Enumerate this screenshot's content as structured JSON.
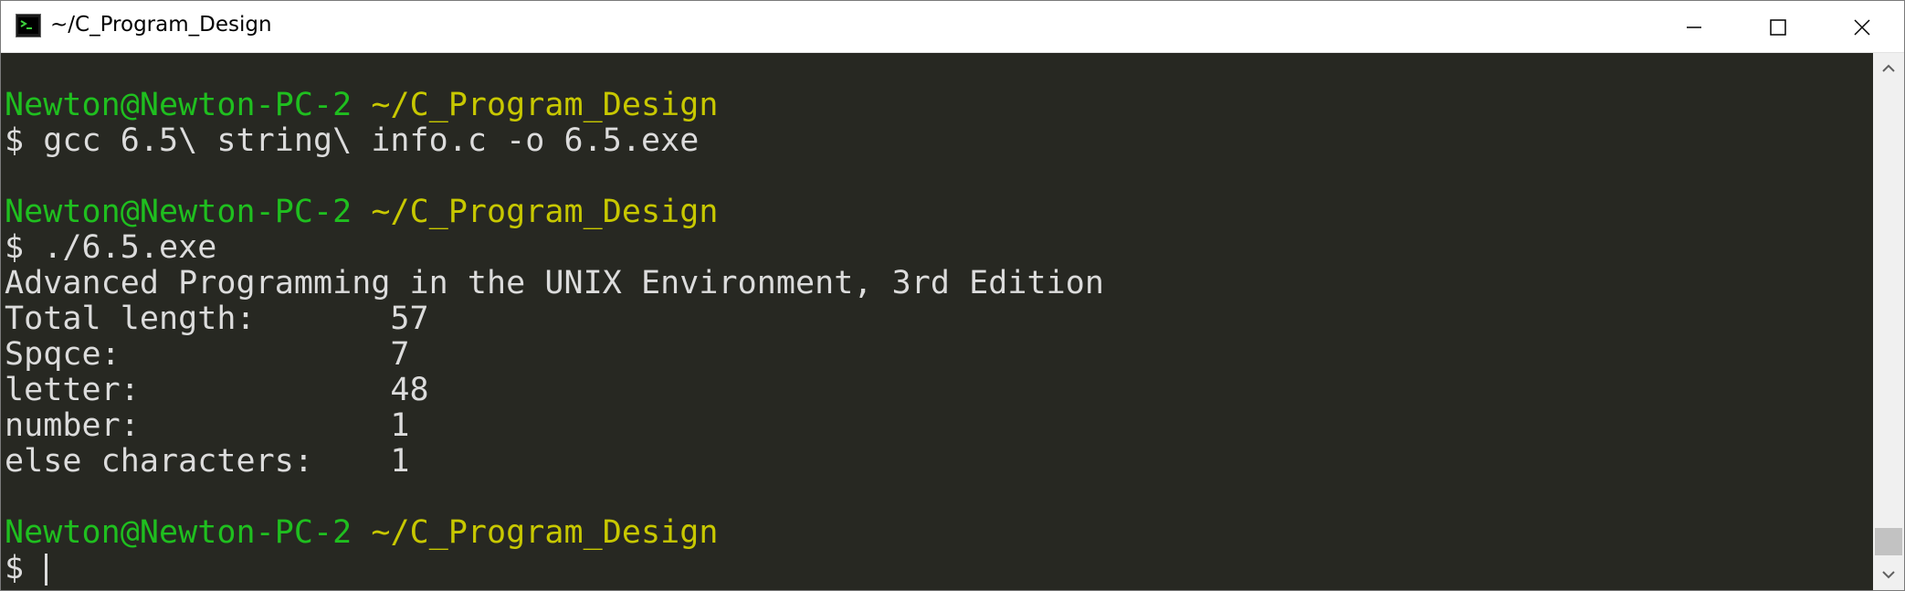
{
  "window": {
    "title": "~/C_Program_Design",
    "buttons": {
      "minimize": "minimize",
      "maximize": "maximize",
      "close": "close"
    }
  },
  "terminal": {
    "prompt1": {
      "user": "Newton@Newton-PC-2",
      "path": "~/C_Program_Design",
      "command": "$ gcc 6.5\\ string\\ info.c -o 6.5.exe"
    },
    "prompt2": {
      "user": "Newton@Newton-PC-2",
      "path": "~/C_Program_Design",
      "command": "$ ./6.5.exe"
    },
    "output": [
      "Advanced Programming in the UNIX Environment, 3rd Edition",
      "Total length:       57",
      "Spqce:              7",
      "letter:             48",
      "number:             1",
      "else characters:    1"
    ],
    "prompt3": {
      "user": "Newton@Newton-PC-2",
      "path": "~/C_Program_Design",
      "command": "$ "
    }
  },
  "colors": {
    "background": "#272822",
    "user": "#1fbf1f",
    "path": "#c8c800",
    "text": "#dcdcdc"
  }
}
